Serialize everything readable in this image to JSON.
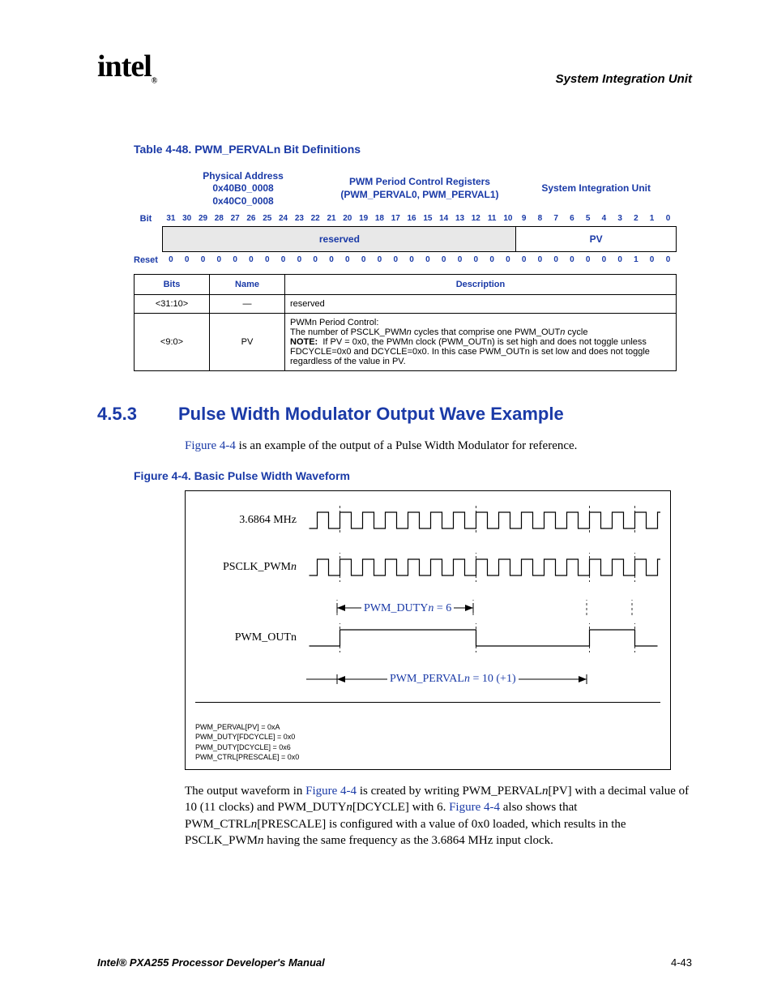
{
  "header": {
    "logo": "intel",
    "section": "System Integration Unit"
  },
  "register_table": {
    "title": "Table 4-48. PWM_PERVALn Bit Definitions",
    "phys_addr_label": "Physical Address",
    "phys_addr_1": "0x40B0_0008",
    "phys_addr_2": "0x40C0_0008",
    "reg_name_1": "PWM Period Control Registers",
    "reg_name_2": "(PWM_PERVAL0, PWM_PERVAL1)",
    "unit": "System Integration Unit",
    "bit_label": "Bit",
    "bits": [
      "31",
      "30",
      "29",
      "28",
      "27",
      "26",
      "25",
      "24",
      "23",
      "22",
      "21",
      "20",
      "19",
      "18",
      "17",
      "16",
      "15",
      "14",
      "13",
      "12",
      "11",
      "10",
      "9",
      "8",
      "7",
      "6",
      "5",
      "4",
      "3",
      "2",
      "1",
      "0"
    ],
    "reserved_label": "reserved",
    "pv_label": "PV",
    "reset_label": "Reset",
    "reset_vals": [
      "0",
      "0",
      "0",
      "0",
      "0",
      "0",
      "0",
      "0",
      "0",
      "0",
      "0",
      "0",
      "0",
      "0",
      "0",
      "0",
      "0",
      "0",
      "0",
      "0",
      "0",
      "0",
      "0",
      "0",
      "0",
      "0",
      "0",
      "0",
      "0",
      "1",
      "0",
      "0"
    ],
    "col_bits": "Bits",
    "col_name": "Name",
    "col_desc": "Description",
    "rows": [
      {
        "bits": "<31:10>",
        "name": "—",
        "desc": "reserved"
      },
      {
        "bits": "<9:0>",
        "name": "PV",
        "desc_l1": "PWMn Period Control:",
        "desc_l2a": "The number of PSCLK_PWM",
        "desc_l2b": " cycles that comprise one PWM_OUT",
        "desc_l2c": " cycle",
        "note_l": "NOTE:",
        "note_1": "If PV = 0x0, the PWMn clock (PWM_OUTn) is set high and does not toggle unless FDCYCLE=0x0 and DCYCLE=0x0. In this case PWM_OUTn is set low and does not toggle regardless of the value in PV."
      }
    ]
  },
  "section_453": {
    "num": "4.5.3",
    "title": "Pulse Width Modulator Output Wave Example",
    "intro_a": "Figure 4-4",
    "intro_b": " is an example of the output of a Pulse Width Modulator for reference."
  },
  "figure": {
    "title": "Figure 4-4. Basic Pulse Width Waveform",
    "row1": "3.6864 MHz",
    "row2_a": "PSCLK_PWM",
    "row2_b": "n",
    "row3": "PWM_OUTn",
    "ann_duty_a": "PWM_DUTY",
    "ann_duty_b": "n",
    "ann_duty_c": " = 6",
    "ann_perval_a": "PWM_PERVAL",
    "ann_perval_b": "n",
    "ann_perval_c": " = 10 (+1)",
    "foot1": "PWM_PERVAL[PV] = 0xA",
    "foot2": "PWM_DUTY[FDCYCLE] = 0x0",
    "foot3": "PWM_DUTY[DCYCLE] = 0x6",
    "foot4": "PWM_CTRL[PRESCALE] = 0x0"
  },
  "bottom_para": {
    "a": "The output waveform in ",
    "link1": "Figure 4-4",
    "b": " is created by writing PWM_PERVAL",
    "c": "[PV] with a decimal value of 10 (11 clocks) and PWM_DUTY",
    "d": "[DCYCLE] with 6. ",
    "link2": "Figure 4-4",
    "e": " also shows that PWM_CTRL",
    "f": "[PRESCALE] is configured with a value of 0x0 loaded, which results in the PSCLK_PWM",
    "g": " having the same frequency as the 3.6864 MHz input clock."
  },
  "footer": {
    "manual": "Intel® PXA255 Processor Developer's Manual",
    "page": "4-43"
  },
  "chart_data": {
    "type": "waveform",
    "signals": [
      {
        "name": "3.6864 MHz",
        "period_units": 1,
        "cycles_shown": 15
      },
      {
        "name": "PSCLK_PWMn",
        "period_units": 1,
        "cycles_shown": 15,
        "prescale": 0
      },
      {
        "name": "PWM_OUTn",
        "period_units": 11,
        "high_units": 6
      }
    ],
    "annotations": [
      {
        "label": "PWM_DUTYn = 6",
        "span_units": 6
      },
      {
        "label": "PWM_PERVALn = 10 (+1)",
        "span_units": 11
      }
    ],
    "registers": {
      "PWM_PERVAL[PV]": "0xA",
      "PWM_DUTY[FDCYCLE]": "0x0",
      "PWM_DUTY[DCYCLE]": "0x6",
      "PWM_CTRL[PRESCALE]": "0x0"
    }
  }
}
